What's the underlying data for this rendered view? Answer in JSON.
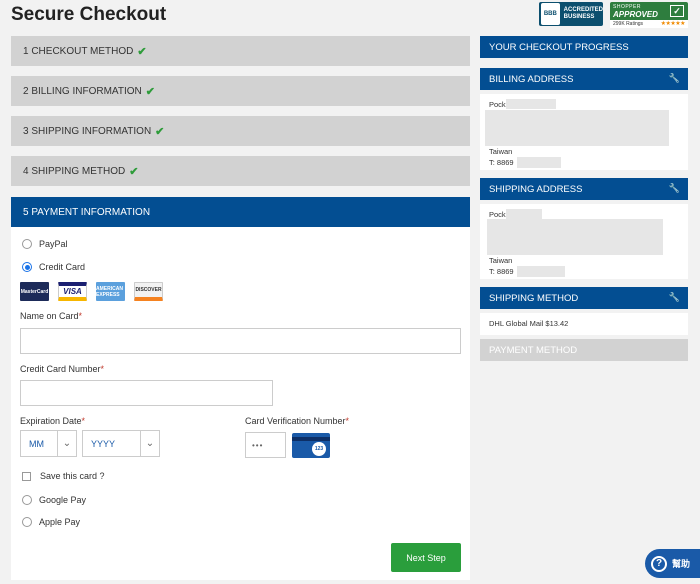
{
  "page": {
    "title": "Secure Checkout"
  },
  "badges": {
    "bbb_seal": "BBB",
    "bbb_text": "ACCREDITED\nBUSINESS",
    "shopper_top": "SHOPPER",
    "shopper_main": "APPROVED",
    "shopper_ratings": "299K Ratings",
    "shopper_stars": "★★★★★",
    "shopper_check": "✓"
  },
  "steps": [
    {
      "label": "1 CHECKOUT METHOD",
      "check": "✔"
    },
    {
      "label": "2 BILLING INFORMATION",
      "check": "✔"
    },
    {
      "label": "3 SHIPPING INFORMATION",
      "check": "✔"
    },
    {
      "label": "4 SHIPPING METHOD",
      "check": "✔"
    },
    {
      "label": "5 PAYMENT INFORMATION"
    }
  ],
  "payment": {
    "options": {
      "paypal": "PayPal",
      "credit_card": "Credit Card",
      "google_pay": "Google Pay",
      "apple_pay": "Apple Pay"
    },
    "selected": "credit_card",
    "card_logos": {
      "mastercard": "MasterCard",
      "visa": "VISA",
      "amex": "AMERICAN EXPRESS",
      "discover": "DISCOVER"
    },
    "name_on_card_label": "Name on Card",
    "card_number_label": "Credit Card Number",
    "expiration_label": "Expiration Date",
    "month_value": "MM",
    "year_value": "YYYY",
    "cvv_label": "Card Verification Number",
    "cvv_placeholder": "•••",
    "cvv_card_digits": "123",
    "required_mark": "*",
    "save_card_label": "Save this card ?",
    "next_button": "Next Step"
  },
  "sidebar": {
    "progress_title": "YOUR CHECKOUT PROGRESS",
    "billing_title": "BILLING ADDRESS",
    "billing_name": "Pock",
    "billing_country": "Taiwan",
    "billing_phone": "T: 8869",
    "shipping_title": "SHIPPING ADDRESS",
    "shipping_name": "Pock",
    "shipping_country": "Taiwan",
    "shipping_phone": "T: 8869",
    "method_title": "SHIPPING METHOD",
    "method_value": "DHL Global Mail $13.42",
    "payment_title": "PAYMENT METHOD",
    "edit_icon": "🔧"
  },
  "help": {
    "label": "幫助",
    "icon": "?"
  }
}
